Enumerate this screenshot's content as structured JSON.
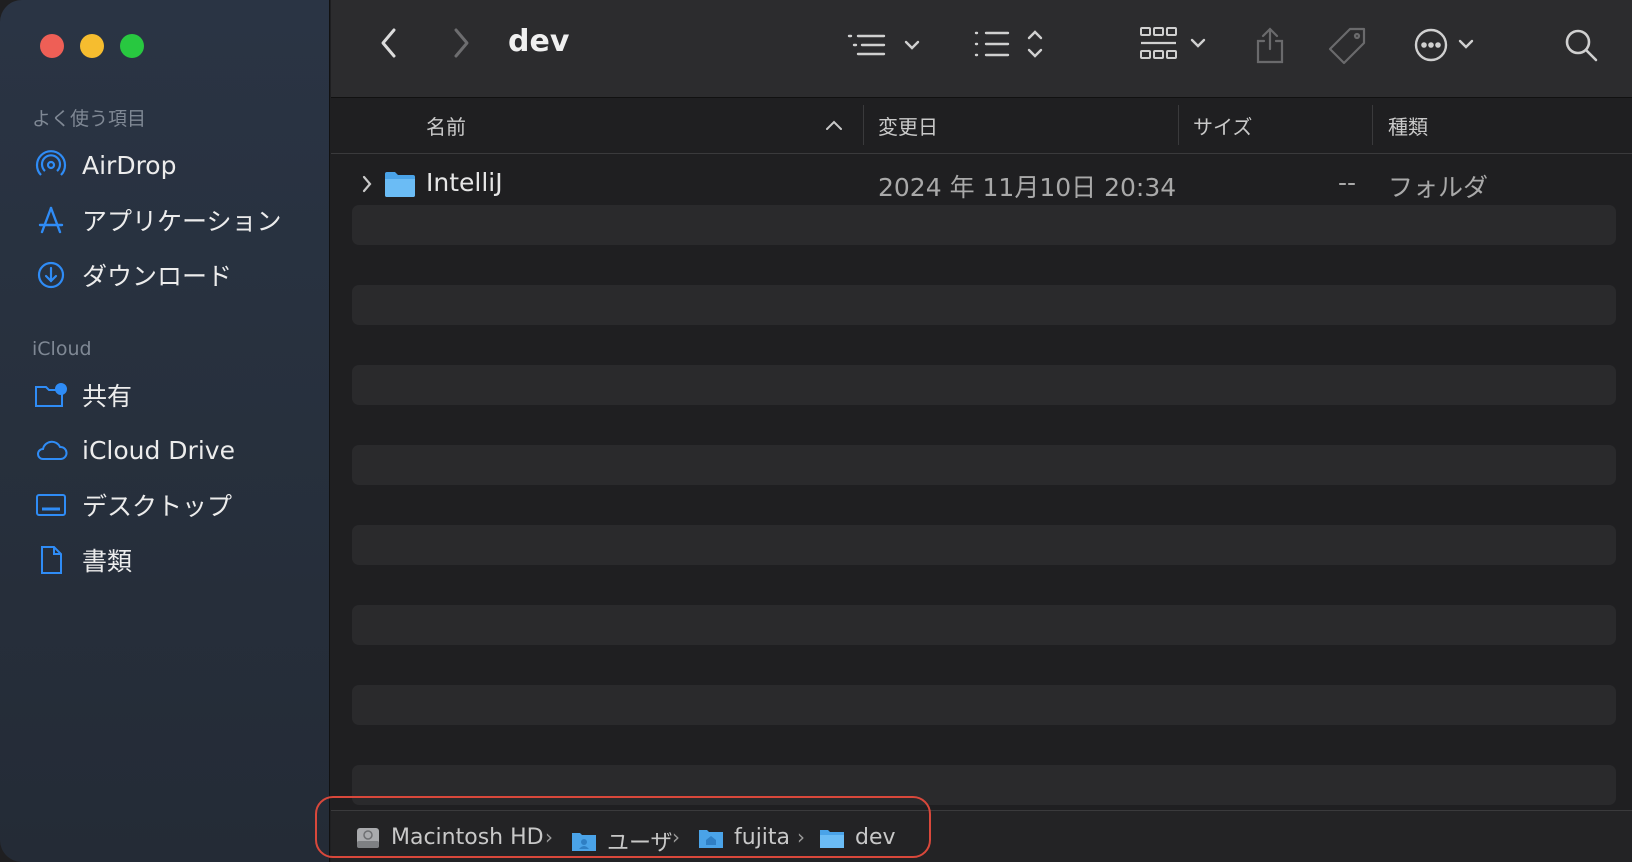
{
  "window": {
    "title": "dev",
    "colors": {
      "close": "#ee5f56",
      "minimize": "#f6bd2f",
      "zoom": "#28c840",
      "accent": "#2f8cf6",
      "highlight": "#d9483b"
    }
  },
  "sidebar": {
    "favorites_title": "よく使う項目",
    "favorites": [
      {
        "label": "AirDrop",
        "icon": "airdrop-icon"
      },
      {
        "label": "アプリケーション",
        "icon": "applications-icon"
      },
      {
        "label": "ダウンロード",
        "icon": "download-icon"
      }
    ],
    "icloud_title": "iCloud",
    "icloud": [
      {
        "label": "共有",
        "icon": "shared-folder-icon"
      },
      {
        "label": "iCloud Drive",
        "icon": "cloud-icon"
      },
      {
        "label": "デスクトップ",
        "icon": "desktop-icon"
      },
      {
        "label": "書類",
        "icon": "document-icon"
      }
    ]
  },
  "columns": {
    "name": "名前",
    "modified": "変更日",
    "size": "サイズ",
    "kind": "種類"
  },
  "files": [
    {
      "name": "IntelliJ",
      "modified": "2024 年 11月10日 20:34",
      "size": "--",
      "kind": "フォルダ"
    }
  ],
  "pathbar": [
    {
      "label": "Macintosh HD",
      "icon": "hard-disk-icon"
    },
    {
      "label": "ユーザ",
      "icon": "users-folder-icon"
    },
    {
      "label": "fujita",
      "icon": "home-folder-icon"
    },
    {
      "label": "dev",
      "icon": "folder-icon"
    }
  ],
  "pathbar_separator": "›"
}
